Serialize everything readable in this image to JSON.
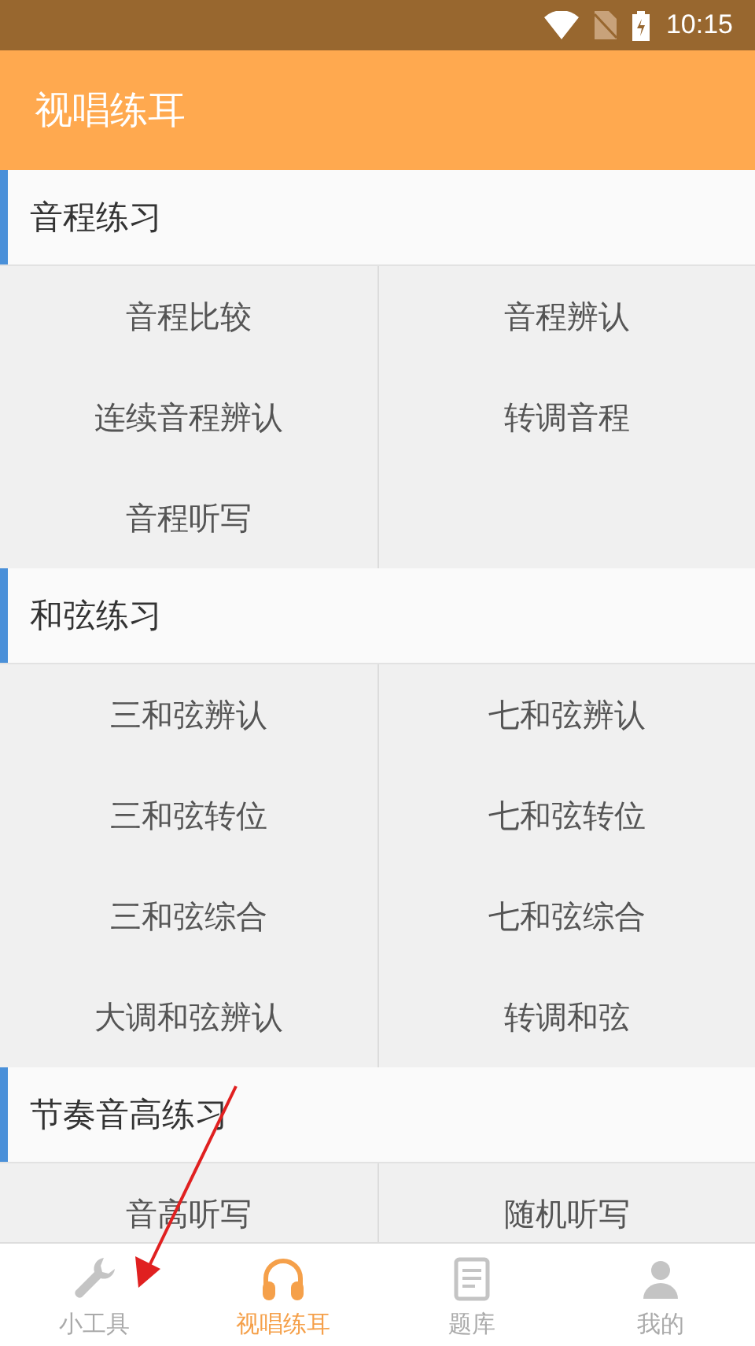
{
  "status_bar": {
    "time": "10:15"
  },
  "app_bar": {
    "title": "视唱练耳"
  },
  "sections": [
    {
      "title": "音程练习",
      "items": [
        "音程比较",
        "音程辨认",
        "连续音程辨认",
        "转调音程",
        "音程听写"
      ]
    },
    {
      "title": "和弦练习",
      "items": [
        "三和弦辨认",
        "七和弦辨认",
        "三和弦转位",
        "七和弦转位",
        "三和弦综合",
        "七和弦综合",
        "大调和弦辨认",
        "转调和弦"
      ]
    },
    {
      "title": "节奏音高练习",
      "items": [
        "音高听写",
        "随机听写"
      ]
    }
  ],
  "bottom_nav": [
    {
      "kind": "wrench",
      "label": "小工具",
      "selected": false
    },
    {
      "kind": "headphones",
      "label": "视唱练耳",
      "selected": true
    },
    {
      "kind": "book",
      "label": "题库",
      "selected": false
    },
    {
      "kind": "person",
      "label": "我的",
      "selected": false
    }
  ]
}
